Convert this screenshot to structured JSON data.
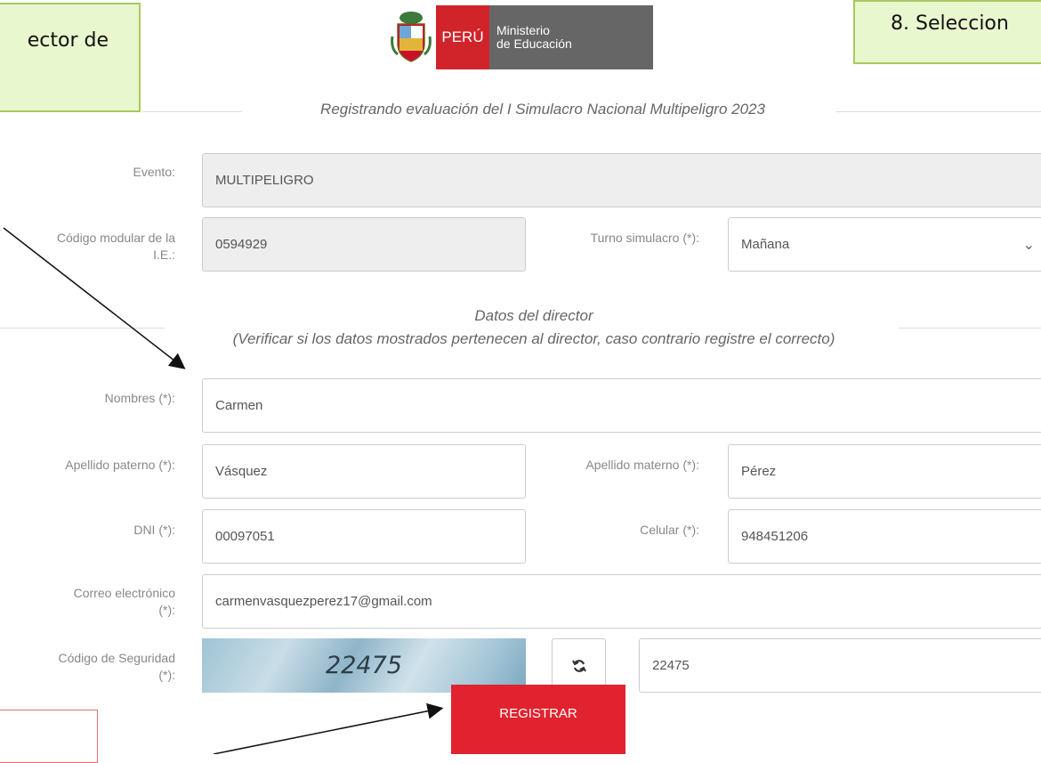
{
  "callouts": {
    "left_text": "ector de",
    "right_text": "8. Seleccion"
  },
  "logo": {
    "country": "PERÚ",
    "ministry_line1": "Ministerio",
    "ministry_line2": "de Educación"
  },
  "form": {
    "section_title": "Registrando evaluación del I Simulacro Nacional Multipeligro 2023",
    "evento_label": "Evento:",
    "evento_value": "MULTIPELIGRO",
    "codigo_label_1": "Código modular de la",
    "codigo_label_2": "I.E.:",
    "codigo_value": "0594929",
    "turno_label": "Turno simulacro (*):",
    "turno_value": "Mañana",
    "director_title": "Datos del director",
    "director_subtitle": "(Verificar si los datos mostrados pertenecen al director, caso contrario registre el correcto)",
    "nombres_label": "Nombres (*):",
    "nombres_value": "Carmen",
    "ap_paterno_label": "Apellido paterno (*):",
    "ap_paterno_value": "Vásquez",
    "ap_materno_label": "Apellido materno (*):",
    "ap_materno_value": "Pérez",
    "dni_label": "DNI (*):",
    "dni_value": "00097051",
    "celular_label": "Celular (*):",
    "celular_value": "948451206",
    "correo_label_1": "Correo electrónico",
    "correo_label_2": "(*):",
    "correo_value": "carmenvasquezperez17@gmail.com",
    "seguridad_label_1": "Código de Seguridad",
    "seguridad_label_2": "(*):",
    "captcha_text": "22475",
    "seguridad_value": "22475",
    "submit_label": "REGISTRAR"
  },
  "colors": {
    "accent_red": "#e0232f",
    "callout_green": "#e9f7cf"
  }
}
